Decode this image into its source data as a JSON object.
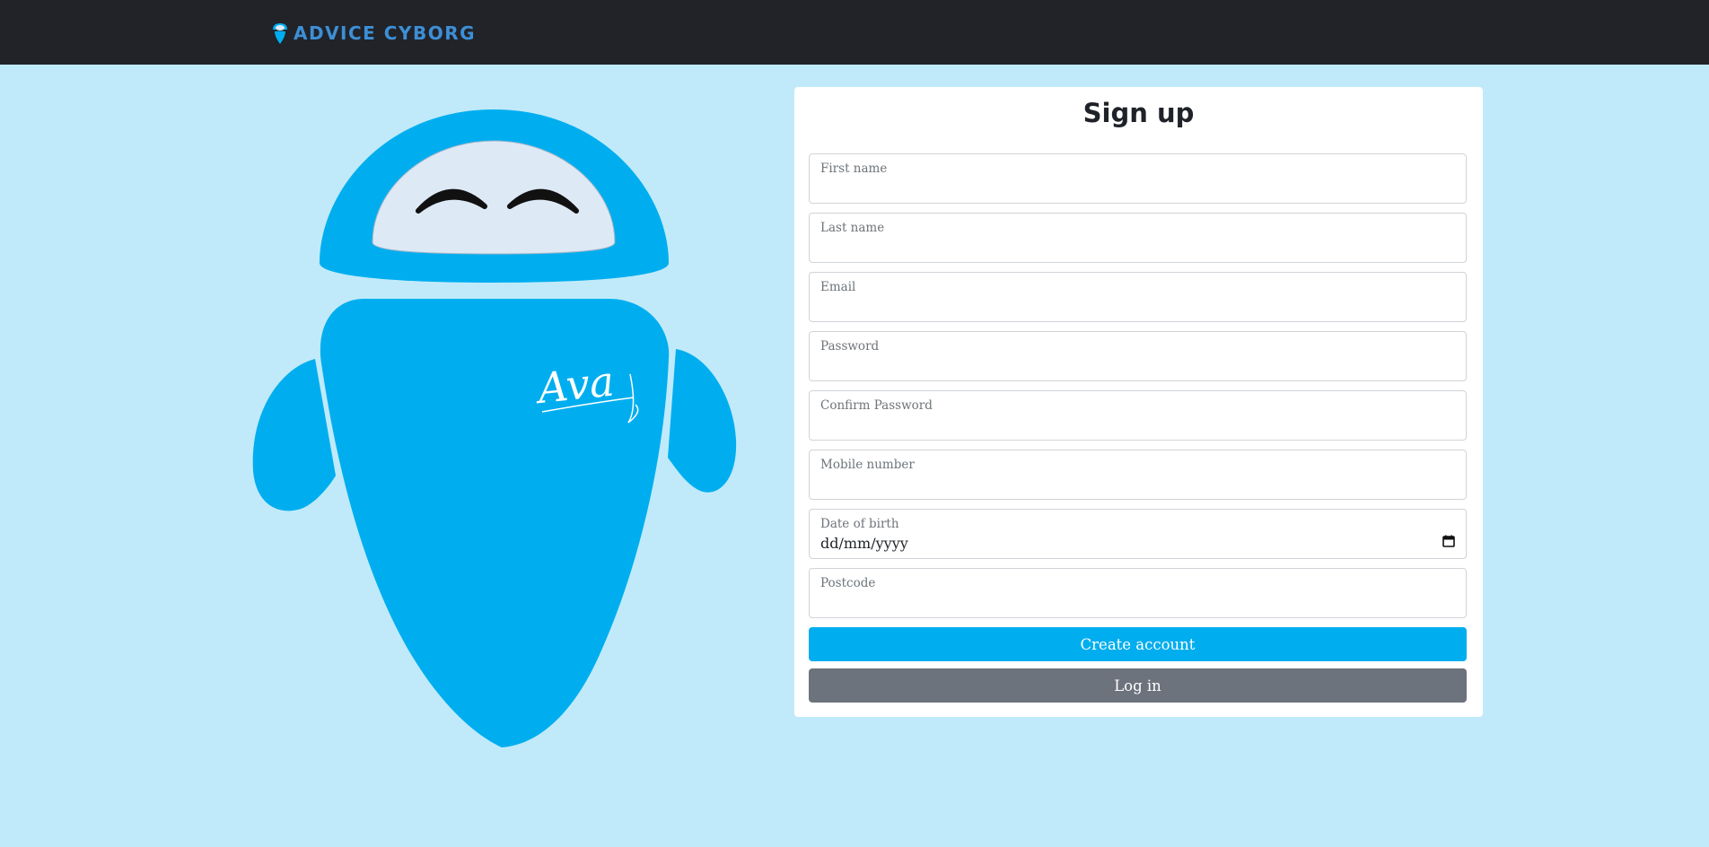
{
  "navbar": {
    "brand_text": "ADVICE CYBORG",
    "brand_icon": "robot-icon",
    "brand_color": "#3d8fd6",
    "background": "#212329"
  },
  "hero": {
    "mascot": "robot-mascot",
    "body_text": "Ava",
    "primary_color": "#00aeef",
    "visor_color": "#dde9f5"
  },
  "form": {
    "title": "Sign up",
    "fields": {
      "first_name": {
        "label": "First name",
        "value": ""
      },
      "last_name": {
        "label": "Last name",
        "value": ""
      },
      "email": {
        "label": "Email",
        "value": ""
      },
      "password": {
        "label": "Password",
        "value": ""
      },
      "confirm_password": {
        "label": "Confirm Password",
        "value": ""
      },
      "mobile": {
        "label": "Mobile number",
        "value": ""
      },
      "dob": {
        "label": "Date of birth",
        "value": "dd/mm/yyyy",
        "icon": "calendar-icon"
      },
      "postcode": {
        "label": "Postcode",
        "value": ""
      }
    },
    "create_label": "Create account",
    "login_label": "Log in",
    "primary_color": "#00aeef",
    "secondary_color": "#6c737d"
  },
  "page_background": "#c0eafa"
}
